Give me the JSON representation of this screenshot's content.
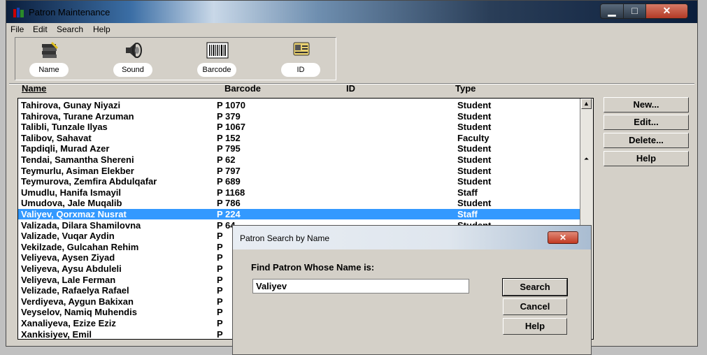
{
  "window": {
    "title": "Patron Maintenance"
  },
  "menu": [
    "File",
    "Edit",
    "Search",
    "Help"
  ],
  "toolbar": [
    {
      "label": "Name",
      "icon": "name-books-icon"
    },
    {
      "label": "Sound",
      "icon": "speaker-icon"
    },
    {
      "label": "Barcode",
      "icon": "barcode-icon"
    },
    {
      "label": "ID",
      "icon": "id-card-icon"
    }
  ],
  "columns": [
    "Name",
    "Barcode",
    "ID",
    "Type"
  ],
  "rows": [
    {
      "name": "Tahirova, Gunay Niyazi",
      "barcode": "P 1070",
      "type": "Student"
    },
    {
      "name": "Tahirova, Turane Arzuman",
      "barcode": "P 379",
      "type": "Student"
    },
    {
      "name": "Talibli, Tunzale Ilyas",
      "barcode": "P 1067",
      "type": "Student"
    },
    {
      "name": "Talibov, Sahavat",
      "barcode": "P 152",
      "type": "Faculty"
    },
    {
      "name": "Tapdiqli, Murad Azer",
      "barcode": "P 795",
      "type": "Student"
    },
    {
      "name": "Tendai, Samantha Shereni",
      "barcode": "P 62",
      "type": "Student"
    },
    {
      "name": "Teymurlu, Asiman Elekber",
      "barcode": "P 797",
      "type": "Student"
    },
    {
      "name": "Teymurova, Zemfira Abdulqafar",
      "barcode": "P 689",
      "type": "Student"
    },
    {
      "name": "Umudlu, Hanifa Ismayil",
      "barcode": "P 1168",
      "type": "Staff"
    },
    {
      "name": "Umudova, Jale Muqalib",
      "barcode": "P 786",
      "type": "Student"
    },
    {
      "name": "Valiyev, Qorxmaz Nusrat",
      "barcode": "P 224",
      "type": "Staff",
      "selected": true
    },
    {
      "name": "Valizada, Dilara Shamilovna",
      "barcode": "P 64",
      "type": "Student"
    },
    {
      "name": "Valizade, Vuqar Aydin",
      "barcode": "P",
      "type": ""
    },
    {
      "name": "Vekilzade, Gulcahan Rehim",
      "barcode": "P",
      "type": ""
    },
    {
      "name": "Veliyeva, Aysen Ziyad",
      "barcode": "P",
      "type": ""
    },
    {
      "name": "Veliyeva, Aysu Abduleli",
      "barcode": "P",
      "type": ""
    },
    {
      "name": "Veliyeva, Lale Ferman",
      "barcode": "P",
      "type": ""
    },
    {
      "name": "Velizade, Rafaelya Rafael",
      "barcode": "P",
      "type": ""
    },
    {
      "name": "Verdiyeva, Aygun Bakixan",
      "barcode": "P",
      "type": ""
    },
    {
      "name": "Veyselov, Namiq Muhendis",
      "barcode": "P",
      "type": ""
    },
    {
      "name": "Xanaliyeva, Ezize Eziz",
      "barcode": "P",
      "type": ""
    },
    {
      "name": "Xankisiyev, Emil",
      "barcode": "P",
      "type": ""
    }
  ],
  "side_buttons": [
    "New...",
    "Edit...",
    "Delete...",
    "Help"
  ],
  "dialog": {
    "title": "Patron Search by Name",
    "label": "Find Patron Whose Name is:",
    "value": "Valiyev",
    "search_label": "Search",
    "cancel_label": "Cancel",
    "help_label": "Help"
  },
  "colors": {
    "selection": "#3399ff",
    "window_bg": "#d4d0c8",
    "list_bg": "#ffffff"
  }
}
